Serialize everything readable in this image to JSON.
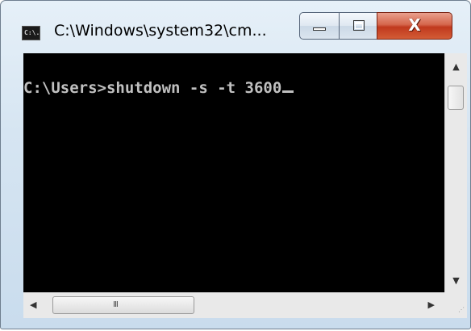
{
  "window": {
    "title": "C:\\Windows\\system32\\cm...",
    "icon_label": "C:\\.",
    "icon_name": "console-app-icon"
  },
  "buttons": {
    "minimize_icon": "minimize-icon",
    "maximize_icon": "maximize-icon",
    "close_glyph": "X"
  },
  "console": {
    "prompt": "C:\\Users>",
    "command": "shutdown -s -t 3600",
    "text_color": "#c0c0c0",
    "background": "#000000"
  },
  "scrollbars": {
    "up_arrow": "▲",
    "down_arrow": "▼",
    "left_arrow": "◀",
    "right_arrow": "▶",
    "h_grip": "III",
    "size_grip": "⋰"
  }
}
